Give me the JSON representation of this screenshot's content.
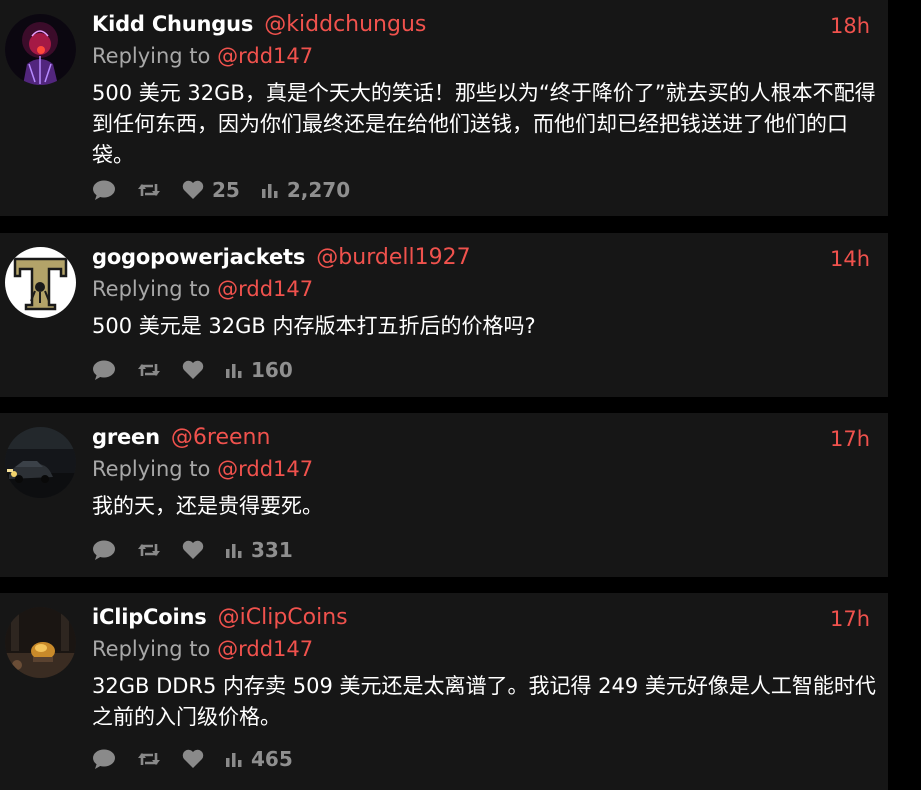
{
  "tweets": [
    {
      "name": "Kidd Chungus",
      "handle": "@kiddchungus",
      "time": "18h",
      "replying_label": "Replying to",
      "replying_handle": "@rdd147",
      "text": "500 美元 32GB，真是个天大的笑话！那些以为“终于降价了”就去买的人根本不配得到任何东西，因为你们最终还是在给他们送钱，而他们却已经把钱送进了他们的口袋。",
      "likes": "25",
      "views": "2,270"
    },
    {
      "name": "gogopowerjackets",
      "handle": "@burdell1927",
      "time": "14h",
      "replying_label": "Replying to",
      "replying_handle": "@rdd147",
      "text": "500 美元是 32GB 内存版本打五折后的价格吗?",
      "likes": "",
      "views": "160"
    },
    {
      "name": "green",
      "handle": "@6reenn",
      "time": "17h",
      "replying_label": "Replying to",
      "replying_handle": "@rdd147",
      "text": "我的天，还是贵得要死。",
      "likes": "",
      "views": "331"
    },
    {
      "name": "iClipCoins",
      "handle": "@iClipCoins",
      "time": "17h",
      "replying_label": "Replying to",
      "replying_handle": "@rdd147",
      "text": "32GB DDR5 内存卖 509 美元还是太离谱了。我记得 249 美元好像是人工智能时代之前的入门级价格。",
      "likes": "",
      "views": "465"
    }
  ],
  "icons": {
    "reply": "comment-icon",
    "retweet": "retweet-icon",
    "like": "heart-icon",
    "views": "bar-chart-icon"
  },
  "colors": {
    "background": "#000000",
    "card": "#161616",
    "accent": "#f0524d",
    "muted": "#8a8a8a"
  }
}
